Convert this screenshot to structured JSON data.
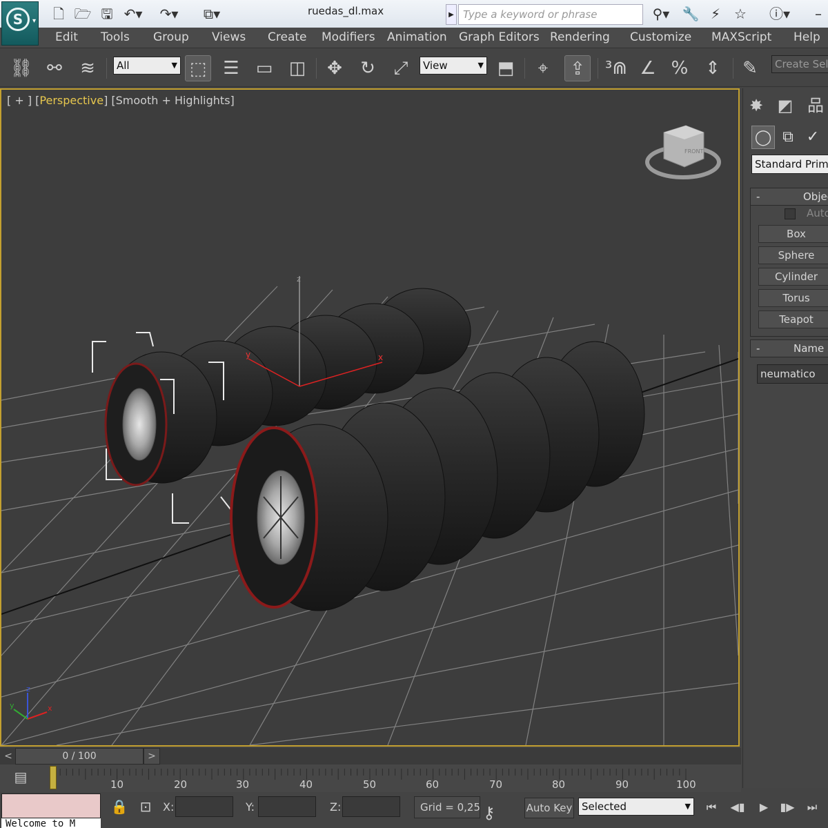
{
  "window": {
    "title": "ruedas_dl.max"
  },
  "search": {
    "placeholder": "Type a keyword or phrase"
  },
  "menu": [
    "Edit",
    "Tools",
    "Group",
    "Views",
    "Create",
    "Modifiers",
    "Animation",
    "Graph Editors",
    "Rendering",
    "Customize",
    "MAXScript",
    "Help"
  ],
  "toolbar": {
    "selection_filter": "All",
    "reference_coord": "View",
    "create_selection_set": "Create Sele"
  },
  "viewport": {
    "label_plus": "[ + ]",
    "label_view": "Perspective",
    "label_shading": "Smooth + Highlights",
    "axis_z": "z",
    "axis_x": "x",
    "axis_y": "y",
    "viewcube_face": "FRONT"
  },
  "command_panel": {
    "category": "Standard Primit",
    "object_type_title": "Objec",
    "autogrid_label": "Auto",
    "primitives": [
      "Box",
      "Sphere",
      "Cylinder",
      "Torus",
      "Teapot"
    ],
    "name_color_title": "Name a",
    "object_name": "neumatico"
  },
  "timeline": {
    "frame_readout": "0 / 100",
    "ticks": [
      "10",
      "20",
      "30",
      "40",
      "50",
      "60",
      "70",
      "80",
      "90",
      "100"
    ]
  },
  "status": {
    "x_label": "X:",
    "y_label": "Y:",
    "z_label": "Z:",
    "grid": "Grid = 0,25",
    "autokey": "Auto Key",
    "key_mode": "Selected",
    "maxscript_welcome": "Welcome to M"
  },
  "colors": {
    "viewport_border": "#c3a030",
    "tire_rubber": "#2a2a2a",
    "tire_stripe_red": "#9b1d1d",
    "grid_line": "#8a8a8a"
  }
}
